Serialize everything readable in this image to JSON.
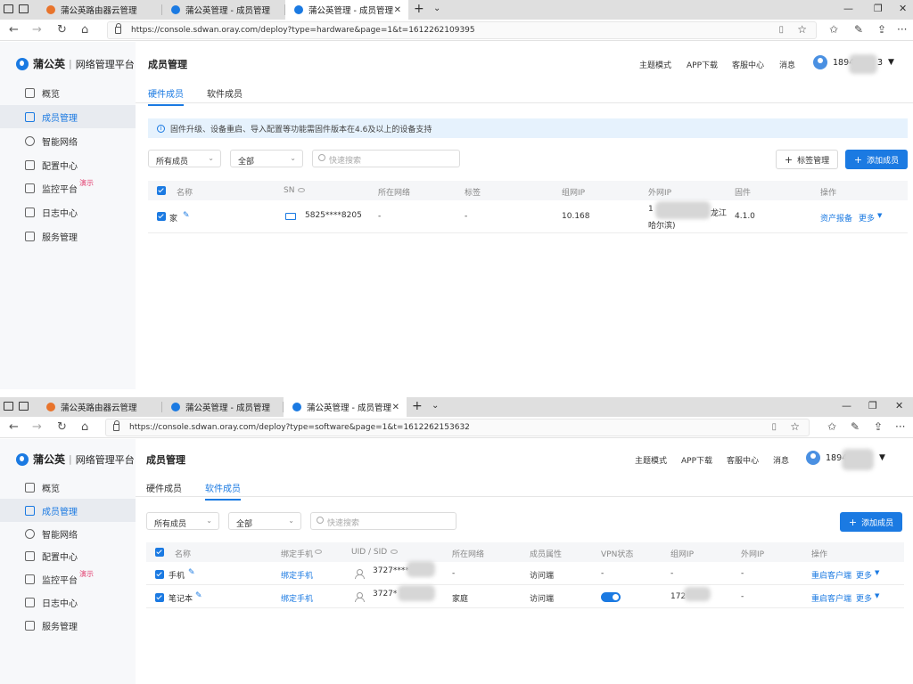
{
  "browser": {
    "tabs": [
      "蒲公英路由器云管理",
      "蒲公英管理 - 成员管理",
      "蒲公英管理 - 成员管理"
    ],
    "url_hardware": "https://console.sdwan.oray.com/deploy?type=hardware&page=1&t=1612262109395",
    "url_software": "https://console.sdwan.oray.com/deploy?type=software&page=1&t=1612262153632"
  },
  "app": {
    "brand": "蒲公英",
    "platform": "网络管理平台",
    "sidebar": [
      {
        "label": "概览",
        "icon": "home-icon"
      },
      {
        "label": "成员管理",
        "icon": "layers-icon"
      },
      {
        "label": "智能网络",
        "icon": "network-icon"
      },
      {
        "label": "配置中心",
        "icon": "grid-icon"
      },
      {
        "label": "监控平台",
        "icon": "monitor-icon",
        "badge": "演示"
      },
      {
        "label": "日志中心",
        "icon": "calendar-icon"
      },
      {
        "label": "服务管理",
        "icon": "document-icon"
      }
    ],
    "page_title": "成员管理",
    "topnav": [
      "主题模式",
      "APP下载",
      "客服中心",
      "消息"
    ],
    "user_prefix": "1894",
    "user_suffix": "3",
    "subtabs": [
      "硬件成员",
      "软件成员"
    ]
  },
  "hardware": {
    "notice": "固件升级、设备重启、导入配置等功能需固件版本在4.6及以上的设备支持",
    "filter_all_members": "所有成员",
    "filter_all": "全部",
    "search_placeholder": "快速搜索",
    "tag_button": "标签管理",
    "add_button": "添加成员",
    "columns": [
      "名称",
      "SN",
      "所在网络",
      "标签",
      "组网IP",
      "外网IP",
      "固件",
      "操作"
    ],
    "row": {
      "name": "家",
      "sn": "5825****8205",
      "network": "-",
      "tag": "-",
      "ip": "10.168",
      "public_ip_1": "1",
      "public_ip_2": "龙江",
      "public_ip_3": "哈尔滨)",
      "firmware": "4.1.0",
      "action1": "资产报备",
      "action2": "更多"
    }
  },
  "software": {
    "filter_all_members": "所有成员",
    "filter_all": "全部",
    "search_placeholder": "快速搜索",
    "add_button": "添加成员",
    "columns": [
      "名称",
      "绑定手机",
      "UID / SID",
      "所在网络",
      "成员属性",
      "VPN状态",
      "组网IP",
      "外网IP",
      "操作"
    ],
    "rows": [
      {
        "name": "手机",
        "phone": "绑定手机",
        "uid": "3727****",
        "network": "-",
        "attr": "访问端",
        "vpn": "-",
        "ip": "-",
        "public_ip": "-",
        "action1": "重启客户端",
        "action2": "更多"
      },
      {
        "name": "笔记本",
        "phone": "绑定手机",
        "uid": "3727*",
        "network": "家庭",
        "attr": "访问端",
        "vpn": "on",
        "ip": "172",
        "public_ip": "-",
        "action1": "重启客户端",
        "action2": "更多"
      }
    ]
  },
  "colors": {
    "accent": "#1b7ae2",
    "demo_badge": "#e23d6e",
    "notice_bg": "#e6f2fd"
  }
}
